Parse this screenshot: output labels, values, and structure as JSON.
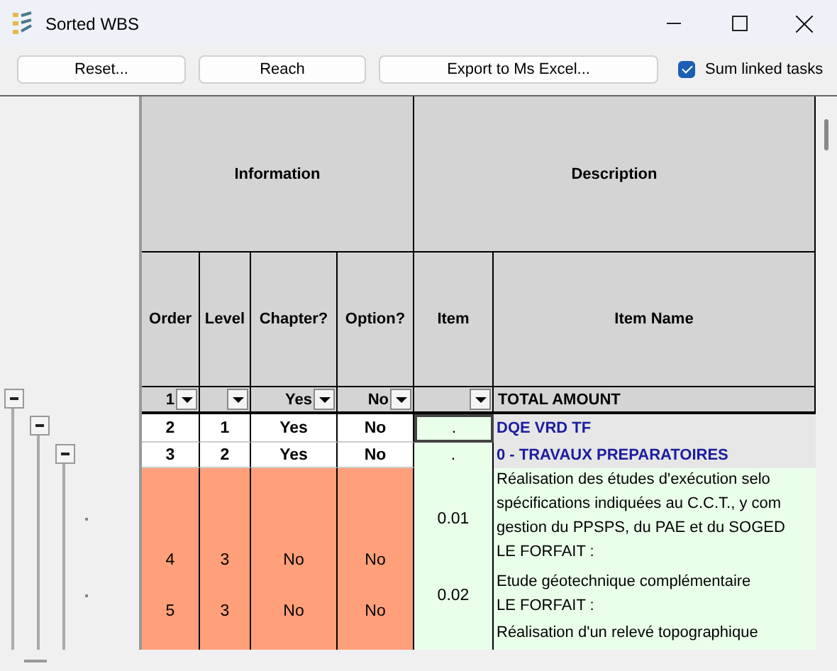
{
  "window": {
    "title": "Sorted WBS"
  },
  "toolbar": {
    "buttons": [
      "Reset...",
      "Reach",
      "Export to Ms Excel..."
    ],
    "checkbox": {
      "label": "Sum linked tasks",
      "checked": true
    }
  },
  "table": {
    "group_headers": [
      {
        "label": "Information",
        "columns": [
          "Order",
          "Level",
          "Chapter?",
          "Option?"
        ]
      },
      {
        "label": "Description",
        "columns": [
          "Item",
          "Item Name"
        ]
      }
    ],
    "filter_row": {
      "cells": [
        {
          "value": "1",
          "dropdown": true
        },
        {
          "dropdown": true
        },
        {
          "value": "Yes",
          "dropdown": true
        },
        {
          "value": "No",
          "dropdown": true
        },
        {
          "dropdown": true
        }
      ],
      "total_label": "TOTAL AMOUNT"
    },
    "rows": [
      {
        "kind": "chapter",
        "selected": true,
        "order": "2",
        "level": "1",
        "chapter": "Yes",
        "option": "No",
        "item": ".",
        "name": "DQE VRD TF"
      },
      {
        "kind": "chapter",
        "selected": false,
        "order": "3",
        "level": "2",
        "chapter": "Yes",
        "option": "No",
        "item": ".",
        "name": "0 - TRAVAUX PREPARATOIRES"
      },
      {
        "kind": "task",
        "selected": false,
        "order": "4",
        "level": "3",
        "chapter": "No",
        "option": "No",
        "item": "0.01",
        "name": "Réalisation des études d'exécution selo\nspécifications indiquées au C.C.T., y com\ngestion du PPSPS, du PAE et du SOGED\nLE FORFAIT :"
      },
      {
        "kind": "task",
        "selected": false,
        "order": "5",
        "level": "3",
        "chapter": "No",
        "option": "No",
        "item": "0.02",
        "name": "Etude géotechnique complémentaire\nLE FORFAIT :"
      },
      {
        "kind": "task",
        "selected": false,
        "name": "Réalisation d'un relevé topographique"
      }
    ]
  },
  "tree": {
    "kind": "group",
    "expanded": true,
    "children": [
      {
        "kind": "group",
        "expanded": true,
        "children": [
          {
            "kind": "group",
            "expanded": true,
            "children": [
              {
                "kind": "leaf"
              },
              {
                "kind": "leaf"
              }
            ]
          }
        ]
      }
    ]
  }
}
